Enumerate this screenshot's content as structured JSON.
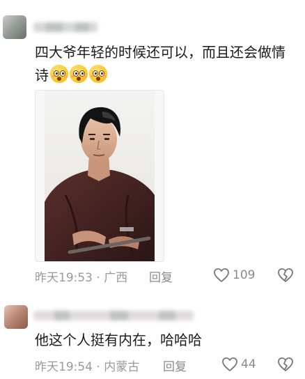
{
  "comments": [
    {
      "text": "四大爷年轻的时候还可以，而且还会做情诗",
      "emoji_icons": [
        "surprised-emoji-icon",
        "surprised-emoji-icon",
        "surprised-emoji-icon"
      ],
      "image": "portrait-photo",
      "time_location": "昨天19:53 · 广西",
      "reply_label": "回复",
      "like_count": "109"
    },
    {
      "text": "他这个人挺有内在，哈哈哈",
      "time_location": "昨天19:54 · 内蒙古",
      "reply_label": "回复",
      "like_count": "44"
    }
  ],
  "colors": {
    "text": "#1b1b1b",
    "meta": "#9a9a9a",
    "background": "#ffffff"
  }
}
